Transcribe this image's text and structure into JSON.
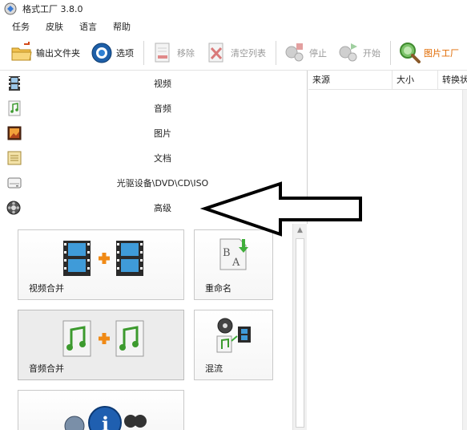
{
  "window": {
    "title": "格式工厂 3.8.0"
  },
  "menu": [
    "任务",
    "皮肤",
    "语言",
    "帮助"
  ],
  "toolbar": {
    "output_folder": "输出文件夹",
    "options": "选项",
    "remove": "移除",
    "clear_list": "清空列表",
    "stop": "停止",
    "start": "开始",
    "picture_factory": "图片工厂"
  },
  "categories": [
    {
      "label": "视频",
      "icon": "video-icon"
    },
    {
      "label": "音频",
      "icon": "audio-icon"
    },
    {
      "label": "图片",
      "icon": "picture-icon"
    },
    {
      "label": "文档",
      "icon": "document-icon"
    },
    {
      "label": "光驱设备\\DVD\\CD\\ISO",
      "icon": "optical-drive-icon"
    },
    {
      "label": "高级",
      "icon": "advanced-icon"
    }
  ],
  "tiles": {
    "video_merge": "视频合并",
    "rename": "重命名",
    "audio_merge": "音频合并",
    "mux": "混流"
  },
  "task_list": {
    "columns": [
      "来源",
      "大小",
      "转换状"
    ]
  },
  "colors": {
    "accent_orange": "#e06a00",
    "disabled_gray": "#9a9a9a",
    "arrow": "#000000"
  }
}
